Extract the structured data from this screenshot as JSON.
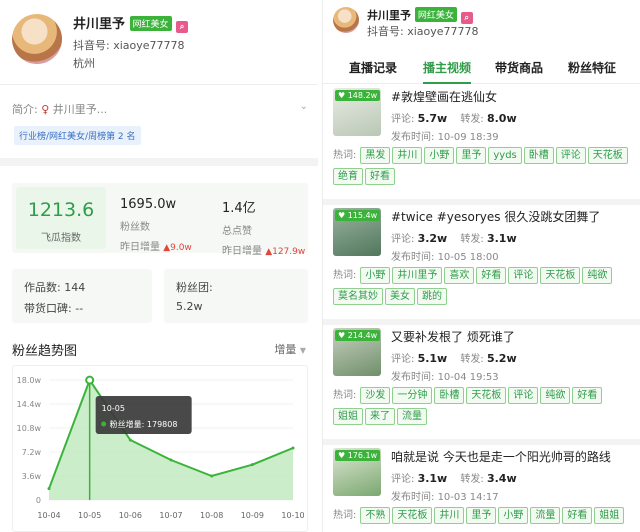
{
  "left": {
    "name": "井川里予",
    "badge": "网红美女",
    "account_label": "抖音号:",
    "account": "xiaoye77778",
    "location": "杭州",
    "intro_label": "简介:",
    "intro_text": "井川里予...",
    "rank_tag": "行业榜/网红美女/周榜第 2 名",
    "stats": {
      "gua_index": "1213.6",
      "gua_label": "飞瓜指数",
      "fans": "1695.0w",
      "fans_label": "粉丝数",
      "fans_inc_label": "昨日增量",
      "fans_inc": "9.0w",
      "likes": "1.4亿",
      "likes_label": "总点赞",
      "likes_inc_label": "昨日增量",
      "likes_inc": "127.9w"
    },
    "works_label": "作品数:",
    "works": "144",
    "goods_label": "带货口碑:",
    "goods": "--",
    "fans_group_label": "粉丝团:",
    "fans_group": "5.2w",
    "trend_title": "粉丝趋势图",
    "trend_select": "增量"
  },
  "chart_data": {
    "type": "area",
    "title": "粉丝趋势图",
    "x": [
      "10-04",
      "10-05",
      "10-06",
      "10-07",
      "10-08",
      "10-09",
      "10-10"
    ],
    "series": [
      {
        "name": "粉丝增量",
        "values": [
          17000,
          179808,
          90000,
          60000,
          36000,
          53000,
          78000
        ]
      }
    ],
    "y_ticks": [
      "0",
      "3.6w",
      "7.2w",
      "10.8w",
      "14.4w",
      "18.0w"
    ],
    "ylim": [
      0,
      180000
    ],
    "tooltip": {
      "date": "10-05",
      "label": "粉丝增量:",
      "value": "179808"
    },
    "accent": "#3bb33b"
  },
  "right": {
    "name": "井川里予",
    "badge": "网红美女",
    "account_label": "抖音号:",
    "account": "xiaoye77778",
    "tabs": [
      "直播记录",
      "播主视频",
      "带货商品",
      "粉丝特征"
    ],
    "active_tab": "播主视频",
    "comment_label": "评论:",
    "share_label": "转发:",
    "time_label": "发布时间:",
    "kw_label": "热词:",
    "videos": [
      {
        "likes": "148.2w",
        "title": "#敦煌壁画在逃仙女",
        "comments": "5.7w",
        "shares": "8.0w",
        "time": "10-09 18:39",
        "keywords": [
          "黑发",
          "井川",
          "小野",
          "里予",
          "yyds",
          "卧槽",
          "评论",
          "天花板",
          "绝育",
          "好看"
        ]
      },
      {
        "likes": "115.4w",
        "title": "#twice #yesoryes 很久没跳女团舞了",
        "comments": "3.2w",
        "shares": "3.1w",
        "time": "10-05 18:00",
        "keywords": [
          "小野",
          "井川里予",
          "喜欢",
          "好看",
          "评论",
          "天花板",
          "纯欲",
          "莫名其妙",
          "美女",
          "跳的"
        ]
      },
      {
        "likes": "214.4w",
        "title": "又要补发根了 烦死谁了",
        "comments": "5.1w",
        "shares": "5.2w",
        "time": "10-04 19:53",
        "keywords": [
          "沙发",
          "一分钟",
          "卧槽",
          "天花板",
          "评论",
          "纯欲",
          "好看",
          "姐姐",
          "来了",
          "流量"
        ]
      },
      {
        "likes": "176.1w",
        "title": "咱就是说 今天也是走一个阳光帅哥的路线",
        "comments": "3.1w",
        "shares": "3.4w",
        "time": "10-03 14:17",
        "keywords": [
          "不熟",
          "天花板",
          "井川",
          "里予",
          "小野",
          "流量",
          "好看",
          "姐姐"
        ]
      }
    ]
  }
}
